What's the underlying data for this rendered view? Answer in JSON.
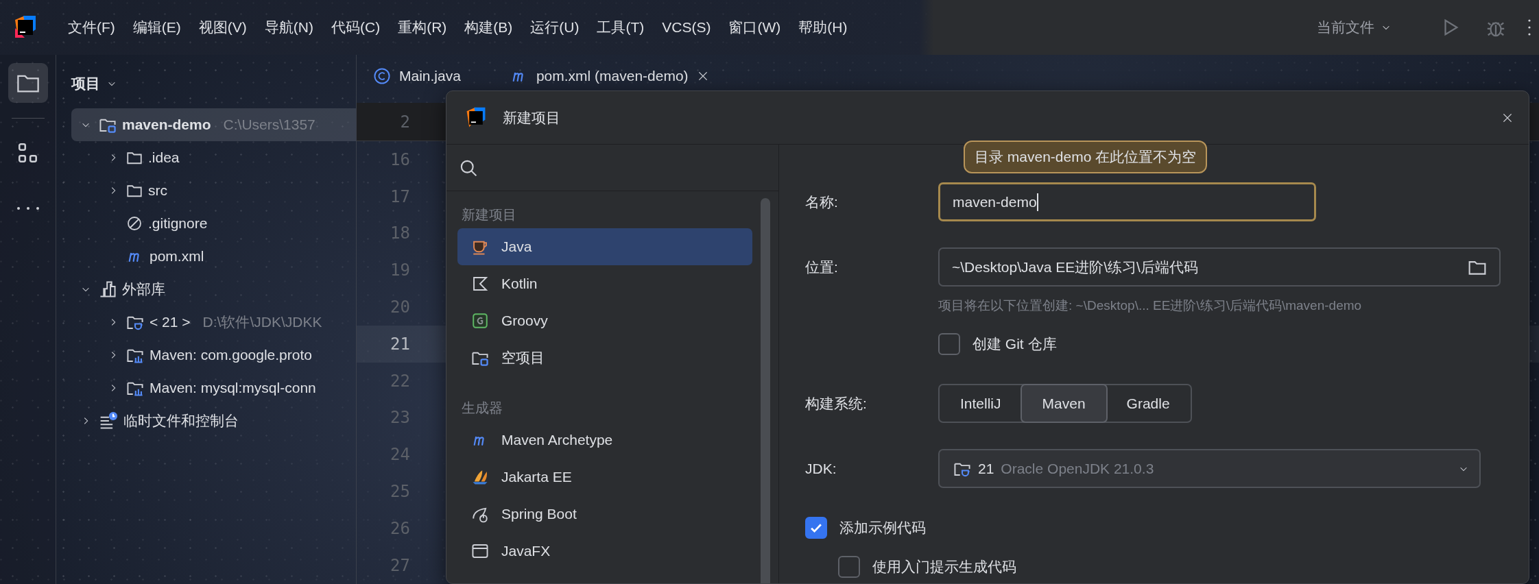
{
  "menu": [
    "文件(F)",
    "编辑(E)",
    "视图(V)",
    "导航(N)",
    "代码(C)",
    "重构(R)",
    "构建(B)",
    "运行(U)",
    "工具(T)",
    "VCS(S)",
    "窗口(W)",
    "帮助(H)"
  ],
  "run_config": "当前文件",
  "tool_strip": [
    {
      "kind": "project",
      "selected": true
    },
    {
      "kind": "structure",
      "selected": false
    },
    {
      "kind": "more",
      "selected": false
    }
  ],
  "project": {
    "title": "项目",
    "tree": [
      {
        "kind": "module",
        "label": "maven-demo",
        "path": "C:\\Users\\1357",
        "expanded": true,
        "selected": true,
        "children": [
          {
            "kind": "folder",
            "label": ".idea",
            "expanded": false,
            "selected": false
          },
          {
            "kind": "folder",
            "label": "src",
            "expanded": false,
            "selected": false
          },
          {
            "kind": "ignore",
            "label": ".gitignore",
            "selected": false
          },
          {
            "kind": "maven",
            "label": "pom.xml",
            "selected": false
          }
        ]
      },
      {
        "kind": "library",
        "label": "外部库",
        "expanded": true,
        "selected": false,
        "children": [
          {
            "kind": "jdk",
            "label": "< 21 >",
            "path": "D:\\软件\\JDK\\JDKK",
            "expanded": false,
            "selected": false
          },
          {
            "kind": "maven-lib",
            "label": "Maven: com.google.proto",
            "expanded": false,
            "selected": false
          },
          {
            "kind": "maven-lib",
            "label": "Maven: mysql:mysql-conn",
            "expanded": false,
            "selected": false
          }
        ]
      },
      {
        "kind": "scratch",
        "label": "临时文件和控制台",
        "expanded": false,
        "selected": false
      }
    ]
  },
  "editor": {
    "tabs": [
      {
        "kind": "class",
        "label": "Main.java",
        "closable": false
      },
      {
        "kind": "maven",
        "label": "pom.xml (maven-demo)",
        "closable": true
      }
    ],
    "sticky_line": "2",
    "line_numbers": [
      {
        "text": "16",
        "current": false
      },
      {
        "text": "17",
        "current": false
      },
      {
        "text": "18",
        "current": false
      },
      {
        "text": "19",
        "current": false
      },
      {
        "text": "20",
        "current": false
      },
      {
        "text": "21",
        "current": true
      },
      {
        "text": "22",
        "current": false
      },
      {
        "text": "23",
        "current": false
      },
      {
        "text": "24",
        "current": false
      },
      {
        "text": "25",
        "current": false
      },
      {
        "text": "26",
        "current": false
      },
      {
        "text": "27",
        "current": false
      }
    ]
  },
  "dialog": {
    "title": "新建项目",
    "sections": [
      {
        "title": "新建项目",
        "items": [
          {
            "kind": "java",
            "label": "Java",
            "selected": true
          },
          {
            "kind": "kotlin",
            "label": "Kotlin",
            "selected": false
          },
          {
            "kind": "groovy",
            "label": "Groovy",
            "selected": false
          },
          {
            "kind": "empty",
            "label": "空项目",
            "selected": false
          }
        ]
      },
      {
        "title": "生成器",
        "items": [
          {
            "kind": "maven",
            "label": "Maven Archetype",
            "selected": false
          },
          {
            "kind": "jakarta",
            "label": "Jakarta EE",
            "selected": false
          },
          {
            "kind": "spring",
            "label": "Spring Boot",
            "selected": false
          },
          {
            "kind": "javafx",
            "label": "JavaFX",
            "selected": false
          }
        ]
      }
    ],
    "form": {
      "name": {
        "label": "名称:",
        "value": "maven-demo",
        "warning": "目录 maven-demo 在此位置不为空"
      },
      "location": {
        "label": "位置:",
        "value": "~\\Desktop\\Java EE进阶\\练习\\后端代码",
        "hint": "项目将在以下位置创建: ~\\Desktop\\... EE进阶\\练习\\后端代码\\maven-demo"
      },
      "git": {
        "label": "创建 Git 仓库",
        "checked": false
      },
      "build_system": {
        "label": "构建系统:",
        "options": [
          {
            "label": "IntelliJ",
            "selected": false
          },
          {
            "label": "Maven",
            "selected": true
          },
          {
            "label": "Gradle",
            "selected": false
          }
        ]
      },
      "jdk": {
        "label": "JDK:",
        "version": "21",
        "name": "Oracle OpenJDK 21.0.3"
      },
      "sample_code": {
        "label": "添加示例代码",
        "checked": true
      },
      "onboarding": {
        "label": "使用入门提示生成代码",
        "checked": false
      }
    }
  }
}
